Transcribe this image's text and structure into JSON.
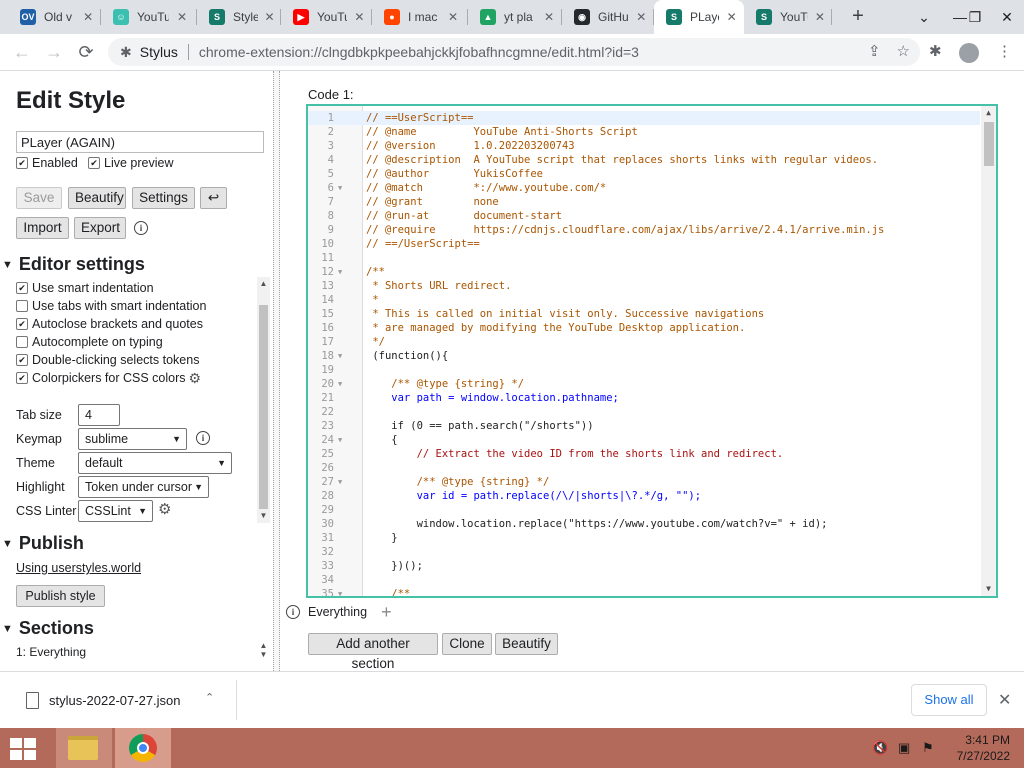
{
  "tabs": [
    {
      "favicon": "OV",
      "favicon_color": "#1f5fa8",
      "title": "Old v"
    },
    {
      "favicon": "☺",
      "favicon_color": "#3bbfb0",
      "title": "YouTu"
    },
    {
      "favicon": "S",
      "favicon_color": "#167a6b",
      "title": "Style"
    },
    {
      "favicon": "▶",
      "favicon_color": "#ff0000",
      "title": "YouTu"
    },
    {
      "favicon": "●",
      "favicon_color": "#ff4500",
      "title": "I mac"
    },
    {
      "favicon": "▲",
      "favicon_color": "#1fa463",
      "title": "yt pla"
    },
    {
      "favicon": "◉",
      "favicon_color": "#24292e",
      "title": "GitHu"
    },
    {
      "favicon": "S",
      "favicon_color": "#167a6b",
      "title": "PLaye"
    },
    {
      "favicon": "S",
      "favicon_color": "#167a6b",
      "title": "YouTu"
    }
  ],
  "addressbar": {
    "site": "Stylus",
    "url": "chrome-extension://clngdbkpkpeebahjckkjfobafhncgmne/edit.html?id=3"
  },
  "left": {
    "heading": "Edit Style",
    "style_name": "PLayer (AGAIN)",
    "enabled_label": "Enabled",
    "live_preview_label": "Live preview",
    "buttons": {
      "save": "Save",
      "beautify": "Beautify",
      "settings": "Settings",
      "undo": "↩",
      "import": "Import",
      "export": "Export"
    },
    "editor_settings_title": "Editor settings",
    "options": [
      {
        "label": "Use smart indentation",
        "checked": true
      },
      {
        "label": "Use tabs with smart indentation",
        "checked": false
      },
      {
        "label": "Autoclose brackets and quotes",
        "checked": true
      },
      {
        "label": "Autocomplete on typing",
        "checked": false
      },
      {
        "label": "Double-clicking selects tokens",
        "checked": true
      },
      {
        "label": "Colorpickers for CSS colors",
        "checked": true
      }
    ],
    "tab_size_label": "Tab size",
    "tab_size": "4",
    "keymap_label": "Keymap",
    "keymap": "sublime",
    "theme_label": "Theme",
    "theme": "default",
    "highlight_label": "Highlight",
    "highlight": "Token under cursor",
    "linter_label": "CSS Linter",
    "linter": "CSSLint",
    "publish_title": "Publish",
    "publish_link": "Using userstyles.world",
    "publish_button": "Publish style",
    "sections_title": "Sections",
    "section_item": "1: Everything"
  },
  "editor": {
    "code_label": "Code 1:",
    "lines": [
      {
        "n": "1",
        "fold": "",
        "cls": "c-com",
        "text": "// ==UserScript=="
      },
      {
        "n": "2",
        "fold": "",
        "cls": "c-com",
        "text": "// @name         YouTube Anti-Shorts Script"
      },
      {
        "n": "3",
        "fold": "",
        "cls": "c-com",
        "text": "// @version      1.0.202203200743"
      },
      {
        "n": "4",
        "fold": "",
        "cls": "c-com",
        "text": "// @description  A YouTube script that replaces shorts links with regular videos."
      },
      {
        "n": "5",
        "fold": "",
        "cls": "c-com",
        "text": "// @author       YukisCoffee"
      },
      {
        "n": "6",
        "fold": "▼",
        "cls": "c-com",
        "text": "// @match        *://www.youtube.com/*"
      },
      {
        "n": "7",
        "fold": "",
        "cls": "c-com",
        "text": "// @grant        none"
      },
      {
        "n": "8",
        "fold": "",
        "cls": "c-com",
        "text": "// @run-at       document-start"
      },
      {
        "n": "9",
        "fold": "",
        "cls": "c-com",
        "text": "// @require      https://cdnjs.cloudflare.com/ajax/libs/arrive/2.4.1/arrive.min.js"
      },
      {
        "n": "10",
        "fold": "",
        "cls": "c-com",
        "text": "// ==/UserScript=="
      },
      {
        "n": "11",
        "fold": "",
        "cls": "c-plain",
        "text": ""
      },
      {
        "n": "12",
        "fold": "▼",
        "cls": "c-com",
        "text": "/**"
      },
      {
        "n": "13",
        "fold": "",
        "cls": "c-com",
        "text": " * Shorts URL redirect."
      },
      {
        "n": "14",
        "fold": "",
        "cls": "c-com",
        "text": " *"
      },
      {
        "n": "15",
        "fold": "",
        "cls": "c-com",
        "text": " * This is called on initial visit only. Successive navigations"
      },
      {
        "n": "16",
        "fold": "",
        "cls": "c-com",
        "text": " * are managed by modifying the YouTube Desktop application."
      },
      {
        "n": "17",
        "fold": "",
        "cls": "c-com",
        "text": " */"
      },
      {
        "n": "18",
        "fold": "▼",
        "cls": "c-plain",
        "text": " (function(){"
      },
      {
        "n": "19",
        "fold": "",
        "cls": "c-plain",
        "text": ""
      },
      {
        "n": "20",
        "fold": "▼",
        "cls": "c-com",
        "text": "    /** @type {string} */"
      },
      {
        "n": "21",
        "fold": "",
        "cls": "c-var",
        "text": "    var path = window.location.pathname;"
      },
      {
        "n": "22",
        "fold": "",
        "cls": "c-plain",
        "text": ""
      },
      {
        "n": "23",
        "fold": "",
        "cls": "c-plain",
        "text": "    if (0 == path.search(\"/shorts\"))"
      },
      {
        "n": "24",
        "fold": "▼",
        "cls": "c-plain",
        "text": "    {"
      },
      {
        "n": "25",
        "fold": "",
        "cls": "c-str",
        "text": "        // Extract the video ID from the shorts link and redirect."
      },
      {
        "n": "26",
        "fold": "",
        "cls": "c-plain",
        "text": ""
      },
      {
        "n": "27",
        "fold": "▼",
        "cls": "c-com",
        "text": "        /** @type {string} */"
      },
      {
        "n": "28",
        "fold": "",
        "cls": "c-var",
        "text": "        var id = path.replace(/\\/|shorts|\\?.*/g, \"\");"
      },
      {
        "n": "29",
        "fold": "",
        "cls": "c-plain",
        "text": ""
      },
      {
        "n": "30",
        "fold": "",
        "cls": "c-plain",
        "text": "        window.location.replace(\"https://www.youtube.com/watch?v=\" + id);"
      },
      {
        "n": "31",
        "fold": "",
        "cls": "c-plain",
        "text": "    }"
      },
      {
        "n": "32",
        "fold": "",
        "cls": "c-plain",
        "text": ""
      },
      {
        "n": "33",
        "fold": "",
        "cls": "c-plain",
        "text": "    })();"
      },
      {
        "n": "34",
        "fold": "",
        "cls": "c-plain",
        "text": ""
      },
      {
        "n": "35",
        "fold": "▼",
        "cls": "c-com",
        "text": "    /**"
      }
    ],
    "applies_to": "Everything",
    "buttons": {
      "add_section": "Add another section",
      "clone": "Clone",
      "beautify": "Beautify"
    }
  },
  "download": {
    "filename": "stylus-2022-07-27.json",
    "show_all": "Show all"
  },
  "taskbar": {
    "time": "3:41 PM",
    "date": "7/27/2022"
  },
  "colors": {
    "accent": "#45c1a8",
    "taskbar": "#b46a5a",
    "link_blue": "#1a73e8"
  }
}
